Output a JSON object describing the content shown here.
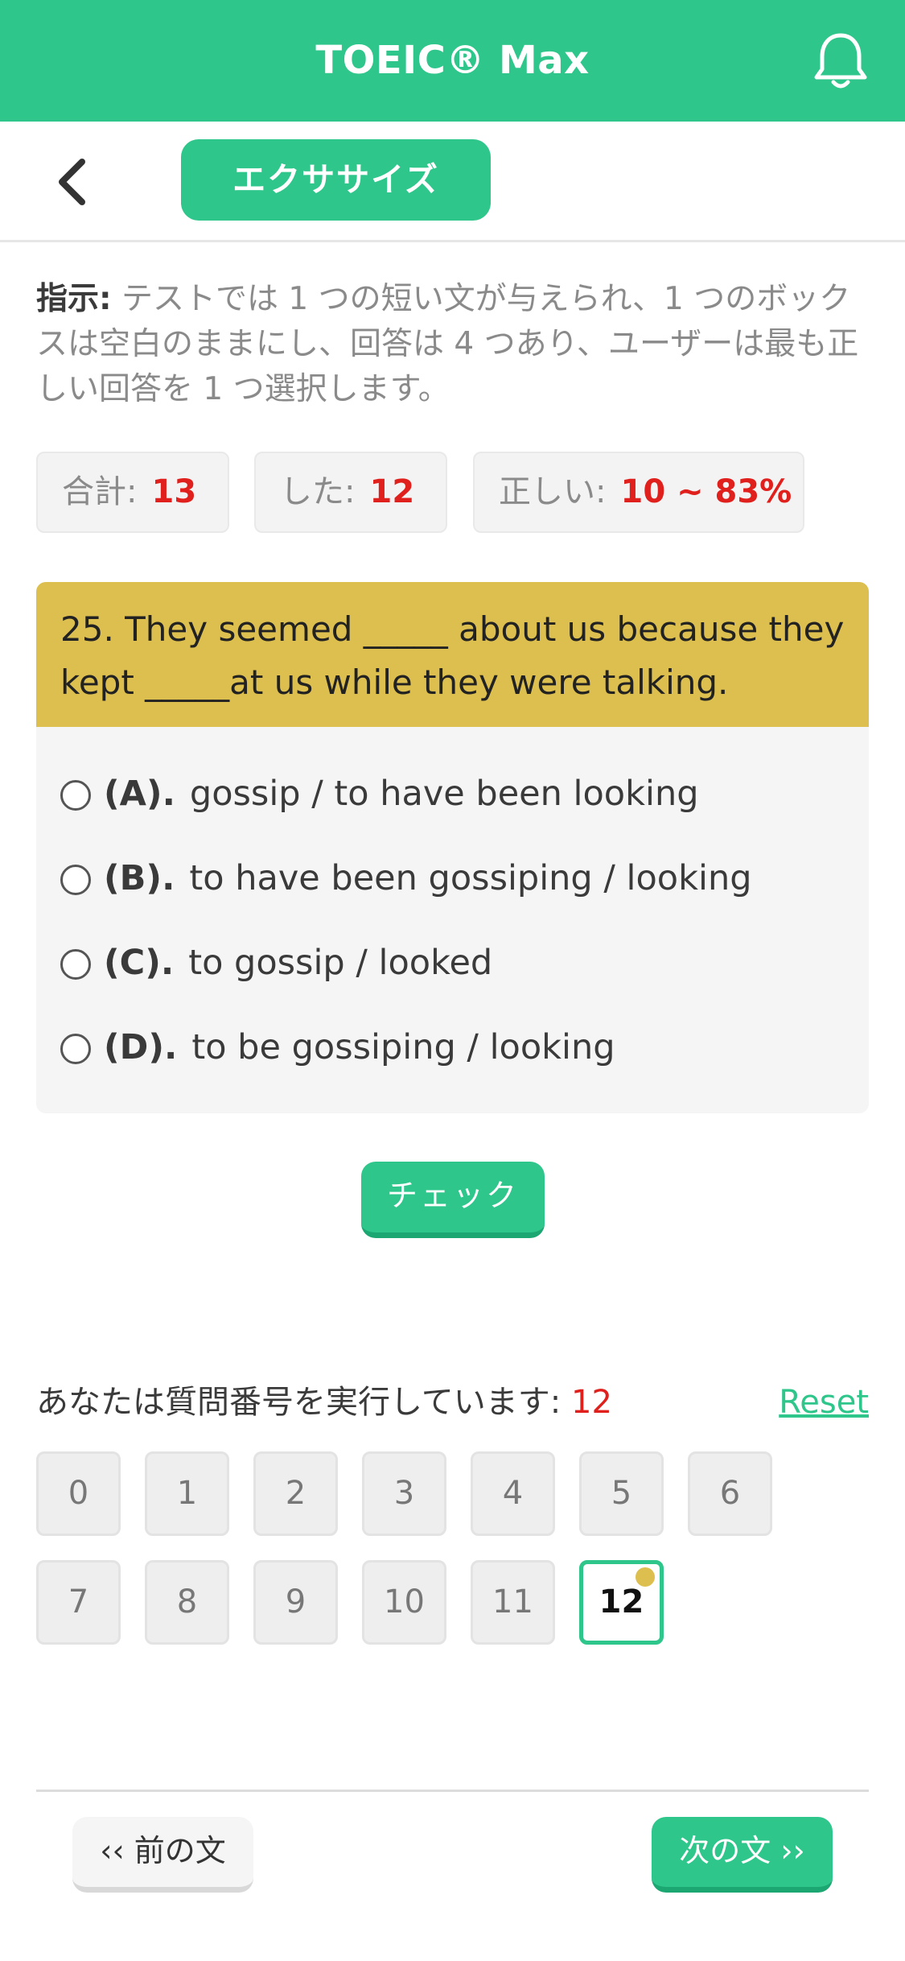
{
  "app": {
    "title": "TOEIC® Max"
  },
  "header": {
    "tab_label": "エクササイズ"
  },
  "instructions": {
    "label": "指示:",
    "text": " テストでは 1 つの短い文が与えられ、1 つのボックスは空白のままにし、回答は 4 つあり、ユーザーは最も正しい回答を 1 つ選択します。"
  },
  "stats": {
    "total_label": "合計:",
    "total_value": "13",
    "done_label": "した:",
    "done_value": "12",
    "correct_label": "正しい:",
    "correct_value": "10 ~ 83%"
  },
  "question": {
    "text": "25. They seemed _____ about us because they kept _____at us while they were talking.",
    "options": [
      {
        "label": "(A).",
        "text": "gossip / to have been looking"
      },
      {
        "label": "(B).",
        "text": "to have been gossiping / looking"
      },
      {
        "label": "(C).",
        "text": "to gossip / looked"
      },
      {
        "label": "(D).",
        "text": "to be gossiping / looking"
      }
    ]
  },
  "check_button": "チェック",
  "progress": {
    "label": "あなたは質問番号を実行しています:",
    "value": "12",
    "reset": "Reset"
  },
  "question_numbers": [
    "0",
    "1",
    "2",
    "3",
    "4",
    "5",
    "6",
    "7",
    "8",
    "9",
    "10",
    "11",
    "12"
  ],
  "current_question": "12",
  "nav": {
    "prev": "‹‹ 前の文",
    "next": "次の文 ››"
  },
  "colors": {
    "brand": "#2ec68a",
    "question_bg": "#dcbf4e",
    "highlight": "#e0201c"
  }
}
